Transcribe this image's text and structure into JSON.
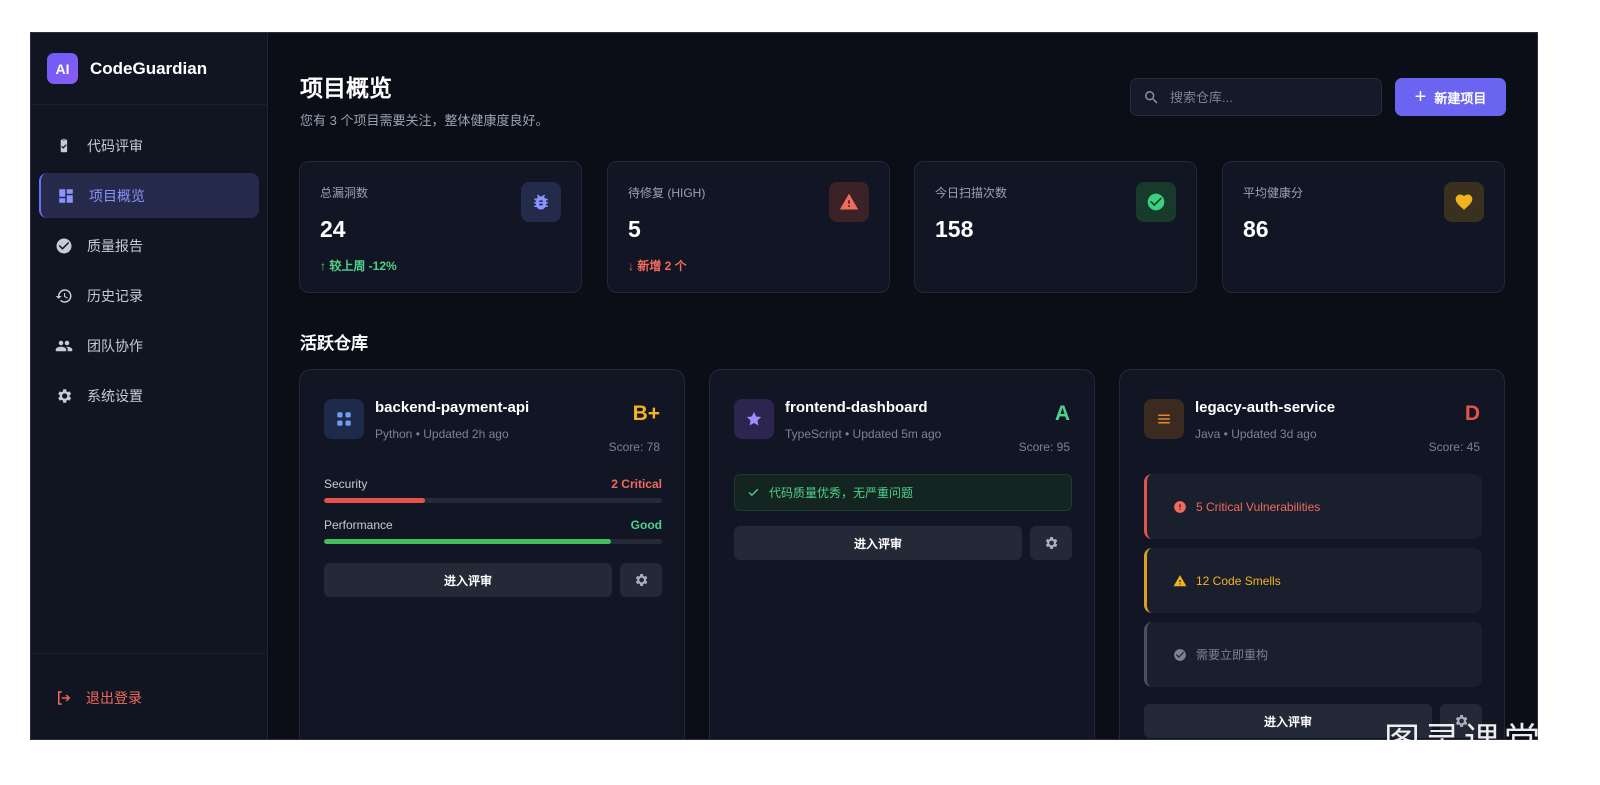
{
  "brand": {
    "logo": "AI",
    "name": "CodeGuardian"
  },
  "sidebar": {
    "items": [
      {
        "label": "代码评审",
        "icon": "clipboard-check-icon",
        "active": false
      },
      {
        "label": "项目概览",
        "icon": "dashboard-icon",
        "active": true
      },
      {
        "label": "质量报告",
        "icon": "check-circle-icon",
        "active": false
      },
      {
        "label": "历史记录",
        "icon": "history-icon",
        "active": false
      },
      {
        "label": "团队协作",
        "icon": "group-icon",
        "active": false
      },
      {
        "label": "系统设置",
        "icon": "gear-icon",
        "active": false
      }
    ],
    "logout_label": "退出登录"
  },
  "header": {
    "title": "项目概览",
    "subtitle": "您有 3 个项目需要关注，整体健康度良好。",
    "search_placeholder": "搜索仓库...",
    "new_button_label": "新建项目"
  },
  "stats": [
    {
      "label": "总漏洞数",
      "value": "24",
      "delta": "较上周 -12%",
      "delta_arrow": "↑",
      "delta_color": "#4fd18b",
      "icon": "bug-icon",
      "icon_color": "#8b93ff",
      "icon_bg": "#232a4a"
    },
    {
      "label": "待修复 (HIGH)",
      "value": "5",
      "delta": "新增 2 个",
      "delta_arrow": "↓",
      "delta_color": "#f06a5d",
      "icon": "warning-icon",
      "icon_color": "#f06a5d",
      "icon_bg": "#3a2226"
    },
    {
      "label": "今日扫描次数",
      "value": "158",
      "delta": "",
      "delta_arrow": "",
      "delta_color": "#4fd18b",
      "icon": "check-circle-icon",
      "icon_color": "#3ccf7e",
      "icon_bg": "#183a2b"
    },
    {
      "label": "平均健康分",
      "value": "86",
      "delta": "",
      "delta_arrow": "",
      "delta_color": "#4fd18b",
      "icon": "heart-icon",
      "icon_color": "#f2b321",
      "icon_bg": "#3a3020"
    }
  ],
  "section_title": "活跃仓库",
  "repos": [
    {
      "name": "backend-payment-api",
      "meta": "Python • Updated 2h ago",
      "grade": "B+",
      "grade_color": "#f2b321",
      "score": "Score: 78",
      "icon": "grid-icon",
      "metrics": [
        {
          "label": "Security",
          "status": "2 Critical",
          "status_color": "#f06a5d",
          "progress": 0.3,
          "bar_color": "#e5534b"
        },
        {
          "label": "Performance",
          "status": "Good",
          "status_color": "#4fd18b",
          "progress": 0.85,
          "bar_color": "#3fbf5f"
        }
      ],
      "review_label": "进入评审"
    },
    {
      "name": "frontend-dashboard",
      "meta": "TypeScript • Updated 5m ago",
      "grade": "A",
      "grade_color": "#4fd18b",
      "score": "Score: 95",
      "icon": "star-icon",
      "note": "代码质量优秀，无严重问题",
      "review_label": "进入评审"
    },
    {
      "name": "legacy-auth-service",
      "meta": "Java • Updated 3d ago",
      "grade": "D",
      "grade_color": "#e5534b",
      "score": "Score: 45",
      "icon": "list-icon",
      "alerts": [
        {
          "text": "5 Critical Vulnerabilities",
          "color": "#f06a5d",
          "border": "#e5534b",
          "icon": "error-icon"
        },
        {
          "text": "12 Code Smells",
          "color": "#f2b321",
          "border": "#d9a11d",
          "icon": "warning-icon"
        },
        {
          "text": "需要立即重构",
          "color": "#7c8293",
          "border": "#4a5060",
          "icon": "check-circle-icon"
        }
      ],
      "review_label": "进入评审"
    }
  ],
  "watermark": "图灵课堂"
}
